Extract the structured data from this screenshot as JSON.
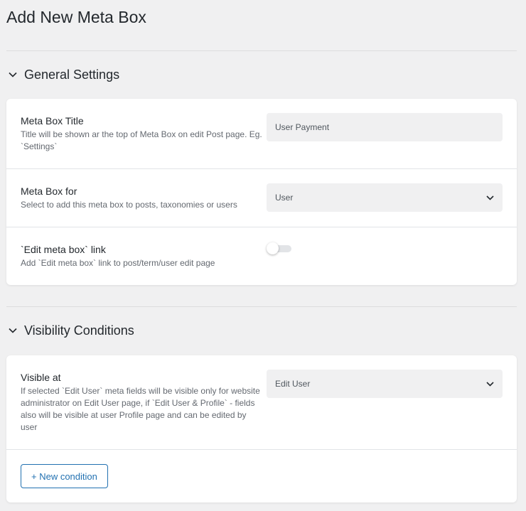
{
  "page": {
    "title": "Add New Meta Box"
  },
  "general": {
    "heading": "General Settings",
    "title_row": {
      "label": "Meta Box Title",
      "desc": "Title will be shown ar the top of Meta Box on edit Post page. Eg. `Settings`",
      "value": "User Payment"
    },
    "for_row": {
      "label": "Meta Box for",
      "desc": "Select to add this meta box to posts, taxonomies or users",
      "value": "User"
    },
    "link_row": {
      "label": "`Edit meta box` link",
      "desc": "Add `Edit meta box` link to post/term/user edit page",
      "enabled": false
    }
  },
  "visibility": {
    "heading": "Visibility Conditions",
    "visible_row": {
      "label": "Visible at",
      "desc": "If selected `Edit User` meta fields will be visible only for website administrator on Edit User page, if `Edit User & Profile` - fields also will be visible at user Profile page and can be edited by user",
      "value": "Edit User"
    },
    "new_condition_label": "+ New condition"
  },
  "colors": {
    "background": "#f0f0f1",
    "accent": "#2271b1",
    "input_bg": "#f0f0f1"
  }
}
